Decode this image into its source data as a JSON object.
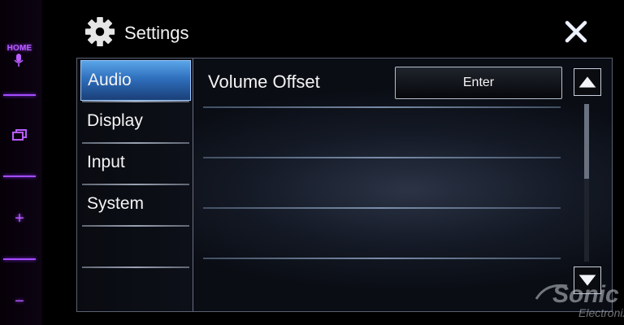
{
  "hardware": {
    "home_label": "HOME",
    "plus_label": "+",
    "minus_label": "−"
  },
  "header": {
    "title": "Settings",
    "close_icon": "close-icon"
  },
  "menu": {
    "items": [
      {
        "label": "Audio",
        "active": true
      },
      {
        "label": "Display",
        "active": false
      },
      {
        "label": "Input",
        "active": false
      },
      {
        "label": "System",
        "active": false
      }
    ]
  },
  "content": {
    "rows": [
      {
        "label": "Volume Offset",
        "button_label": "Enter"
      }
    ]
  },
  "colors": {
    "accent": "#3f86d6",
    "hardware_glow": "#a64cff"
  }
}
